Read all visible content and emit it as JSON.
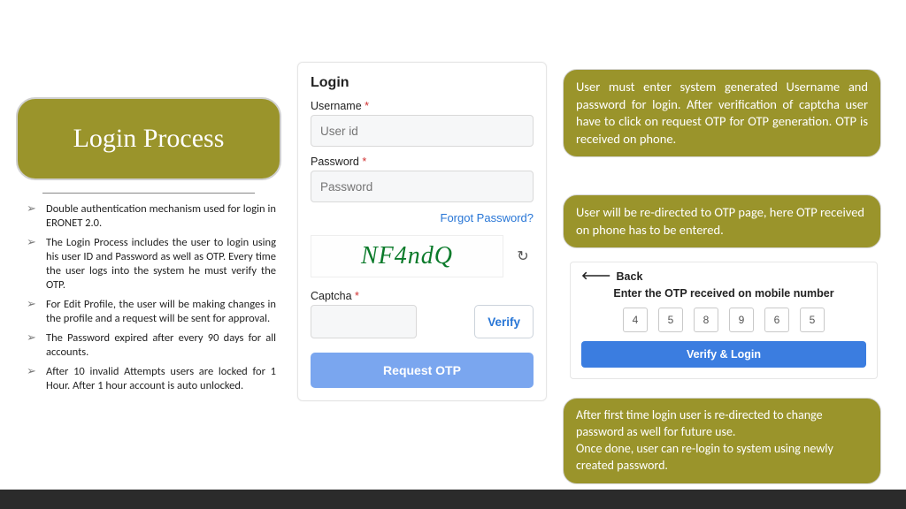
{
  "title": "Login Process",
  "bullets": [
    "Double authentication mechanism used for login in ERONET 2.0.",
    "The Login Process includes the user to login using his user ID and Password as well as OTP. Every time the user logs into the system he must verify the OTP.",
    "For Edit Profile, the user will be making changes in the profile and a request will be sent for approval.",
    "The Password  expired  after every 90 days for all accounts.",
    "After 10 invalid Attempts users are locked for 1 Hour. After 1 hour account is auto unlocked."
  ],
  "login": {
    "heading": "Login",
    "username_label": "Username",
    "username_ph": "User id",
    "password_label": "Password",
    "password_ph": "Password",
    "forgot": "Forgot Password?",
    "captcha_img": "NF4ndQ",
    "captcha_label": "Captcha",
    "verify": "Verify",
    "request_otp": "Request OTP"
  },
  "notes": {
    "n1": "User must enter system generated Username and password for login. After verification of captcha user have to click on request OTP for OTP generation. OTP is received on phone.",
    "n2": "User will be re-directed to OTP page, here OTP received on phone has to be entered.",
    "n3": "After first time login user is re-directed to change password as well for future use.\nOnce done, user can re-login to system using newly created password."
  },
  "otp": {
    "back": "Back",
    "msg": "Enter the OTP received on mobile number",
    "digits": [
      "4",
      "5",
      "8",
      "9",
      "6",
      "5"
    ],
    "btn": "Verify & Login"
  }
}
